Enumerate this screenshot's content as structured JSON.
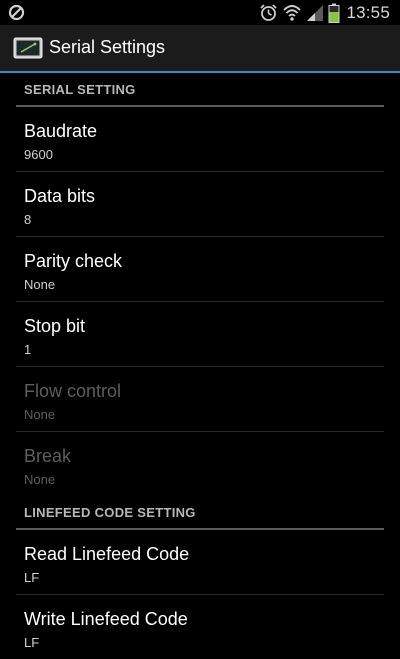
{
  "status_bar": {
    "left_icon": "no-sync-icon",
    "icons": [
      "alarm-icon",
      "wifi-icon",
      "signal-icon",
      "battery-icon"
    ],
    "time": "13:55"
  },
  "action_bar": {
    "icon": "app-icon",
    "title": "Serial Settings"
  },
  "sections": [
    {
      "label": "SERIAL SETTING",
      "items": [
        {
          "title": "Baudrate",
          "summary": "9600",
          "enabled": true
        },
        {
          "title": "Data bits",
          "summary": "8",
          "enabled": true
        },
        {
          "title": "Parity check",
          "summary": "None",
          "enabled": true
        },
        {
          "title": "Stop bit",
          "summary": "1",
          "enabled": true
        },
        {
          "title": "Flow control",
          "summary": "None",
          "enabled": false
        },
        {
          "title": "Break",
          "summary": "None",
          "enabled": false
        }
      ]
    },
    {
      "label": "LINEFEED CODE SETTING",
      "items": [
        {
          "title": "Read Linefeed Code",
          "summary": "LF",
          "enabled": true
        },
        {
          "title": "Write Linefeed Code",
          "summary": "LF",
          "enabled": true
        }
      ]
    }
  ],
  "colors": {
    "accent": "#3a8ac9",
    "battery": "#8bc53f",
    "disabled_text": "#5e5e5e"
  }
}
